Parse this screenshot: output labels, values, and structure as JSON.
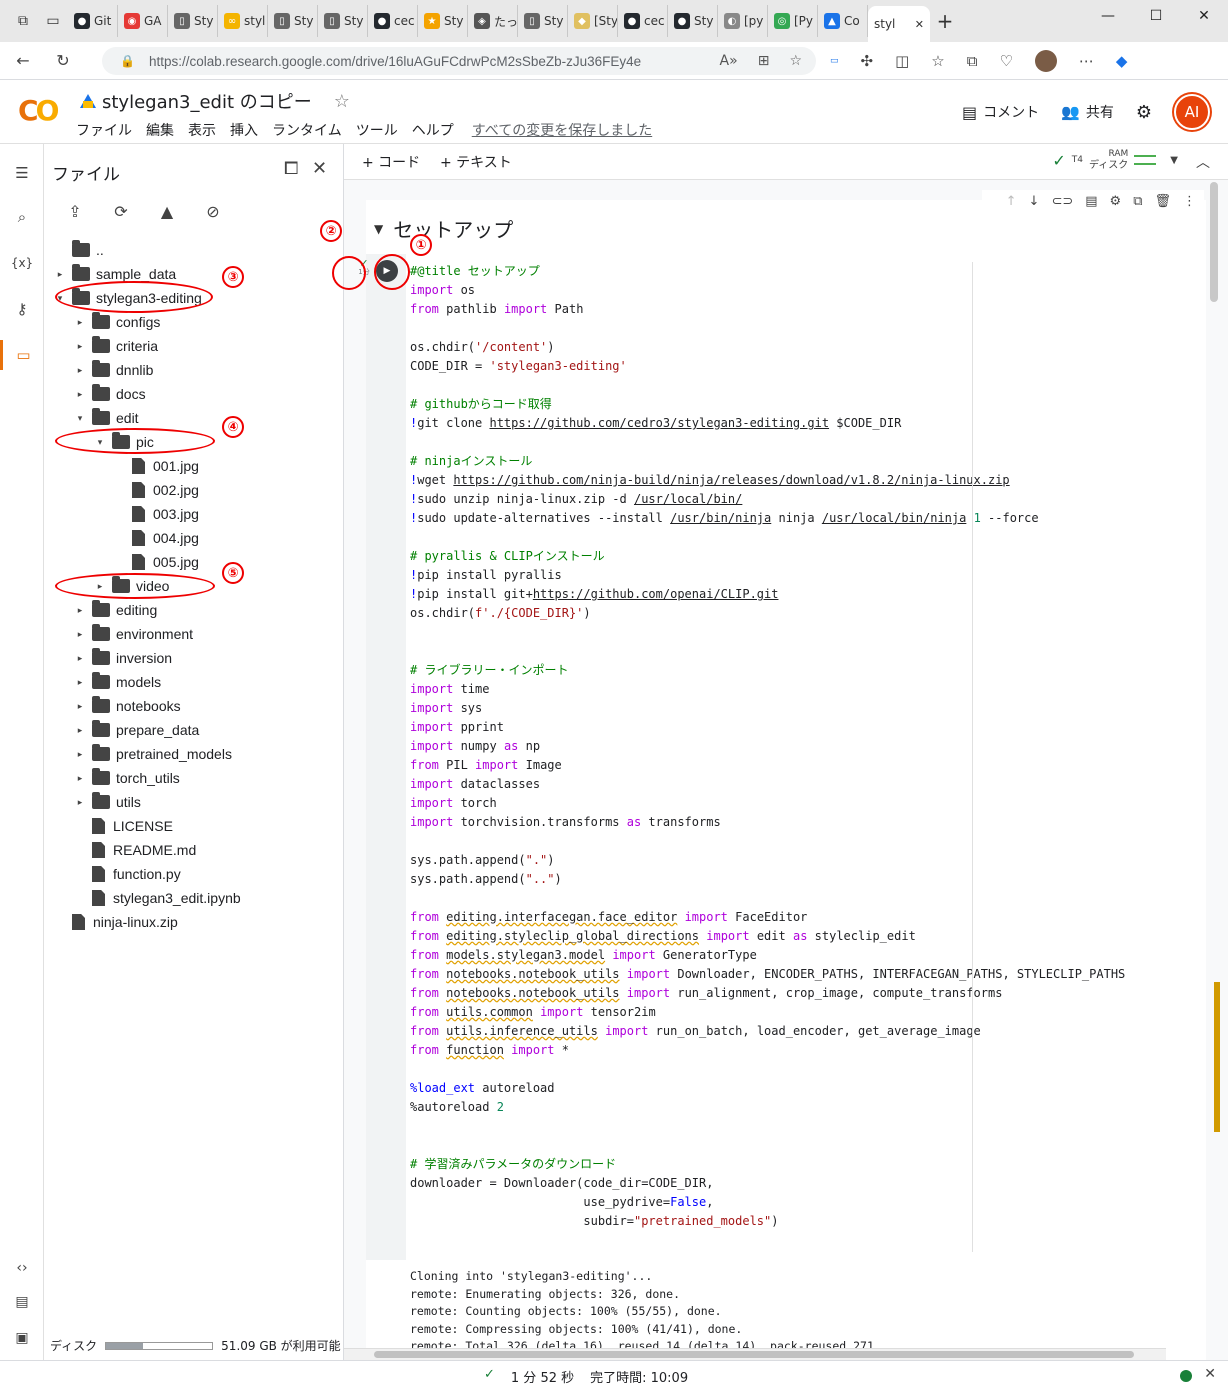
{
  "browser": {
    "tabs": [
      {
        "label": "Git",
        "color": "#24292f",
        "glyph": "●"
      },
      {
        "label": "GA",
        "color": "#e53935",
        "glyph": "◉"
      },
      {
        "label": "Sty",
        "color": "#666666",
        "glyph": "▯"
      },
      {
        "label": "styl",
        "color": "#f4b400",
        "glyph": "∞"
      },
      {
        "label": "Sty",
        "color": "#666666",
        "glyph": "▯"
      },
      {
        "label": "Sty",
        "color": "#666666",
        "glyph": "▯"
      },
      {
        "label": "cec",
        "color": "#24292f",
        "glyph": "●"
      },
      {
        "label": "Sty",
        "color": "#f4a300",
        "glyph": "★"
      },
      {
        "label": "たっ",
        "color": "#555555",
        "glyph": "◈"
      },
      {
        "label": "Sty",
        "color": "#666666",
        "glyph": "▯"
      },
      {
        "label": "[Sty",
        "color": "#e0c060",
        "glyph": "◆"
      },
      {
        "label": "cec",
        "color": "#24292f",
        "glyph": "●"
      },
      {
        "label": "Sty",
        "color": "#24292f",
        "glyph": "●"
      },
      {
        "label": "[py",
        "color": "#888888",
        "glyph": "◐"
      },
      {
        "label": "[Py",
        "color": "#34a853",
        "glyph": "◎"
      },
      {
        "label": "Co",
        "color": "#1a73e8",
        "glyph": "▲"
      }
    ],
    "active_tab": {
      "label": "styl",
      "close": "✕"
    },
    "url": "https://colab.research.google.com/drive/16luAGuFCdrwPcM2sSbeZb-zJu36FEy4e"
  },
  "colab": {
    "logo": "CO",
    "notebook_title": "stylegan3_edit のコピー",
    "menu": [
      "ファイル",
      "編集",
      "表示",
      "挿入",
      "ランタイム",
      "ツール",
      "ヘルプ"
    ],
    "saved_status": "すべての変更を保存しました",
    "comment_label": "コメント",
    "share_label": "共有",
    "user_initials": "AI"
  },
  "files_panel": {
    "title": "ファイル",
    "tree": [
      {
        "name": "..",
        "depth": 0,
        "type": "up",
        "caret": ""
      },
      {
        "name": "sample_data",
        "depth": 0,
        "type": "folder",
        "caret": "▸"
      },
      {
        "name": "stylegan3-editing",
        "depth": 0,
        "type": "folder",
        "caret": "▾"
      },
      {
        "name": "configs",
        "depth": 1,
        "type": "folder",
        "caret": "▸"
      },
      {
        "name": "criteria",
        "depth": 1,
        "type": "folder",
        "caret": "▸"
      },
      {
        "name": "dnnlib",
        "depth": 1,
        "type": "folder",
        "caret": "▸"
      },
      {
        "name": "docs",
        "depth": 1,
        "type": "folder",
        "caret": "▸"
      },
      {
        "name": "edit",
        "depth": 1,
        "type": "folder",
        "caret": "▾"
      },
      {
        "name": "pic",
        "depth": 2,
        "type": "folder",
        "caret": "▾"
      },
      {
        "name": "001.jpg",
        "depth": 3,
        "type": "file",
        "caret": ""
      },
      {
        "name": "002.jpg",
        "depth": 3,
        "type": "file",
        "caret": ""
      },
      {
        "name": "003.jpg",
        "depth": 3,
        "type": "file",
        "caret": ""
      },
      {
        "name": "004.jpg",
        "depth": 3,
        "type": "file",
        "caret": ""
      },
      {
        "name": "005.jpg",
        "depth": 3,
        "type": "file",
        "caret": ""
      },
      {
        "name": "video",
        "depth": 2,
        "type": "folder",
        "caret": "▸"
      },
      {
        "name": "editing",
        "depth": 1,
        "type": "folder",
        "caret": "▸"
      },
      {
        "name": "environment",
        "depth": 1,
        "type": "folder",
        "caret": "▸"
      },
      {
        "name": "inversion",
        "depth": 1,
        "type": "folder",
        "caret": "▸"
      },
      {
        "name": "models",
        "depth": 1,
        "type": "folder",
        "caret": "▸"
      },
      {
        "name": "notebooks",
        "depth": 1,
        "type": "folder",
        "caret": "▸"
      },
      {
        "name": "prepare_data",
        "depth": 1,
        "type": "folder",
        "caret": "▸"
      },
      {
        "name": "pretrained_models",
        "depth": 1,
        "type": "folder",
        "caret": "▸"
      },
      {
        "name": "torch_utils",
        "depth": 1,
        "type": "folder",
        "caret": "▸"
      },
      {
        "name": "utils",
        "depth": 1,
        "type": "folder",
        "caret": "▸"
      },
      {
        "name": "LICENSE",
        "depth": 1,
        "type": "file",
        "caret": ""
      },
      {
        "name": "README.md",
        "depth": 1,
        "type": "file",
        "caret": ""
      },
      {
        "name": "function.py",
        "depth": 1,
        "type": "file",
        "caret": ""
      },
      {
        "name": "stylegan3_edit.ipynb",
        "depth": 1,
        "type": "file",
        "caret": ""
      },
      {
        "name": "ninja-linux.zip",
        "depth": 0,
        "type": "file",
        "caret": ""
      }
    ],
    "disk_label": "ディスク",
    "disk_free": "51.09 GB が利用可能",
    "disk_used_fraction": 0.35
  },
  "toolbar": {
    "add_code": "+ コード",
    "add_text": "+ テキスト",
    "runtime": "T4",
    "ram_label": "RAM",
    "disk_label": "ディスク"
  },
  "notebook": {
    "section_title": "セットアップ",
    "exec_time_short": "1分",
    "code_lines": [
      [
        [
          "c",
          "#@title セットアップ"
        ]
      ],
      [
        [
          "k",
          "import"
        ],
        [
          "",
          " os"
        ]
      ],
      [
        [
          "k",
          "from"
        ],
        [
          "",
          " pathlib "
        ],
        [
          "k",
          "import"
        ],
        [
          "",
          " Path"
        ]
      ],
      [],
      [
        [
          "",
          "os.chdir("
        ],
        [
          "s",
          "'/content'"
        ],
        [
          "",
          ")"
        ]
      ],
      [
        [
          "",
          "CODE_DIR = "
        ],
        [
          "s",
          "'stylegan3-editing'"
        ]
      ],
      [],
      [
        [
          "c",
          "# githubからコード取得"
        ]
      ],
      [
        [
          "m",
          "!"
        ],
        [
          "",
          "git clone "
        ],
        [
          "u",
          "https://github.com/cedro3/stylegan3-editing.git"
        ],
        [
          "",
          " $CODE_DIR"
        ]
      ],
      [],
      [
        [
          "c",
          "# ninjaインストール"
        ]
      ],
      [
        [
          "m",
          "!"
        ],
        [
          "",
          "wget "
        ],
        [
          "u",
          "https://github.com/ninja-build/ninja/releases/download/v1.8.2/ninja-linux.zip"
        ]
      ],
      [
        [
          "m",
          "!"
        ],
        [
          "",
          "sudo unzip ninja-linux.zip -d "
        ],
        [
          "u",
          "/usr/local/bin/"
        ]
      ],
      [
        [
          "m",
          "!"
        ],
        [
          "",
          "sudo update-alternatives --install "
        ],
        [
          "u",
          "/usr/bin/ninja"
        ],
        [
          "",
          " ninja "
        ],
        [
          "u",
          "/usr/local/bin/ninja"
        ],
        [
          "b",
          " 1"
        ],
        [
          "",
          " --force"
        ]
      ],
      [],
      [
        [
          "c",
          "# pyrallis & CLIPインストール"
        ]
      ],
      [
        [
          "m",
          "!"
        ],
        [
          "",
          "pip install pyrallis"
        ]
      ],
      [
        [
          "m",
          "!"
        ],
        [
          "",
          "pip install git+"
        ],
        [
          "u",
          "https://github.com/openai/CLIP.git"
        ]
      ],
      [
        [
          "",
          "os.chdir("
        ],
        [
          "s",
          "f'./{CODE_DIR}'"
        ],
        [
          "",
          ")"
        ]
      ],
      [],
      [],
      [
        [
          "c",
          "# ライブラリー・インポート"
        ]
      ],
      [
        [
          "k",
          "import"
        ],
        [
          "",
          " time"
        ]
      ],
      [
        [
          "k",
          "import"
        ],
        [
          "",
          " sys"
        ]
      ],
      [
        [
          "k",
          "import"
        ],
        [
          "",
          " pprint"
        ]
      ],
      [
        [
          "k",
          "import"
        ],
        [
          "",
          " numpy "
        ],
        [
          "k",
          "as"
        ],
        [
          "",
          " np"
        ]
      ],
      [
        [
          "k",
          "from"
        ],
        [
          "",
          " PIL "
        ],
        [
          "k",
          "import"
        ],
        [
          "",
          " Image"
        ]
      ],
      [
        [
          "k",
          "import"
        ],
        [
          "",
          " dataclasses"
        ]
      ],
      [
        [
          "k",
          "import"
        ],
        [
          "",
          " torch"
        ]
      ],
      [
        [
          "k",
          "import"
        ],
        [
          "",
          " torchvision.transforms "
        ],
        [
          "k",
          "as"
        ],
        [
          "",
          " transforms"
        ]
      ],
      [],
      [
        [
          "",
          "sys.path.append("
        ],
        [
          "s",
          "\".\""
        ],
        [
          "",
          ")"
        ]
      ],
      [
        [
          "",
          "sys.path.append("
        ],
        [
          "s",
          "\"..\""
        ],
        [
          "",
          ")"
        ]
      ],
      [],
      [
        [
          "k",
          "from"
        ],
        [
          "",
          " "
        ],
        [
          "w",
          "editing.interfacegan.face_editor"
        ],
        [
          "",
          " "
        ],
        [
          "k",
          "import"
        ],
        [
          "",
          " FaceEditor"
        ]
      ],
      [
        [
          "k",
          "from"
        ],
        [
          "",
          " "
        ],
        [
          "w",
          "editing.styleclip_global_directions"
        ],
        [
          "",
          " "
        ],
        [
          "k",
          "import"
        ],
        [
          "",
          " edit "
        ],
        [
          "k",
          "as"
        ],
        [
          "",
          " styleclip_edit"
        ]
      ],
      [
        [
          "k",
          "from"
        ],
        [
          "",
          " "
        ],
        [
          "w",
          "models.stylegan3.model"
        ],
        [
          "",
          " "
        ],
        [
          "k",
          "import"
        ],
        [
          "",
          " GeneratorType"
        ]
      ],
      [
        [
          "k",
          "from"
        ],
        [
          "",
          " "
        ],
        [
          "w",
          "notebooks.notebook_utils"
        ],
        [
          "",
          " "
        ],
        [
          "k",
          "import"
        ],
        [
          "",
          " Downloader, ENCODER_PATHS, INTERFACEGAN_PATHS, STYLECLIP_PATHS"
        ]
      ],
      [
        [
          "k",
          "from"
        ],
        [
          "",
          " "
        ],
        [
          "w",
          "notebooks.notebook_utils"
        ],
        [
          "",
          " "
        ],
        [
          "k",
          "import"
        ],
        [
          "",
          " run_alignment, crop_image, compute_transforms"
        ]
      ],
      [
        [
          "k",
          "from"
        ],
        [
          "",
          " "
        ],
        [
          "w",
          "utils.common"
        ],
        [
          "",
          " "
        ],
        [
          "k",
          "import"
        ],
        [
          "",
          " tensor2im"
        ]
      ],
      [
        [
          "k",
          "from"
        ],
        [
          "",
          " "
        ],
        [
          "w",
          "utils.inference_utils"
        ],
        [
          "",
          " "
        ],
        [
          "k",
          "import"
        ],
        [
          "",
          " run_on_batch, load_encoder, get_average_image"
        ]
      ],
      [
        [
          "k",
          "from"
        ],
        [
          "",
          " "
        ],
        [
          "w",
          "function"
        ],
        [
          "",
          " "
        ],
        [
          "k",
          "import"
        ],
        [
          "",
          " *"
        ]
      ],
      [],
      [
        [
          "m",
          "%load_ext"
        ],
        [
          "",
          " autoreload"
        ]
      ],
      [
        [
          "",
          "%autoreload "
        ],
        [
          "b",
          "2"
        ]
      ],
      [],
      [],
      [
        [
          "c",
          "# 学習済みパラメータのダウンロード"
        ]
      ],
      [
        [
          "",
          "downloader = Downloader(code_dir=CODE_DIR,"
        ]
      ],
      [
        [
          "",
          "                        use_pydrive="
        ],
        [
          "m",
          "False"
        ],
        [
          "",
          ","
        ]
      ],
      [
        [
          "",
          "                        subdir="
        ],
        [
          "s",
          "\"pretrained_models\""
        ],
        [
          "",
          ")"
        ]
      ]
    ],
    "output_lines": [
      "Cloning into 'stylegan3-editing'...",
      "remote: Enumerating objects: 326, done.",
      "remote: Counting objects: 100% (55/55), done.",
      "remote: Compressing objects: 100% (41/41), done.",
      "remote: Total 326 (delta 16), reused 14 (delta 14), pack-reused 271"
    ]
  },
  "status": {
    "elapsed": "1 分 52 秒",
    "completed": "完了時間: 10:09"
  },
  "annotations": [
    "①",
    "②",
    "③",
    "④",
    "⑤"
  ]
}
